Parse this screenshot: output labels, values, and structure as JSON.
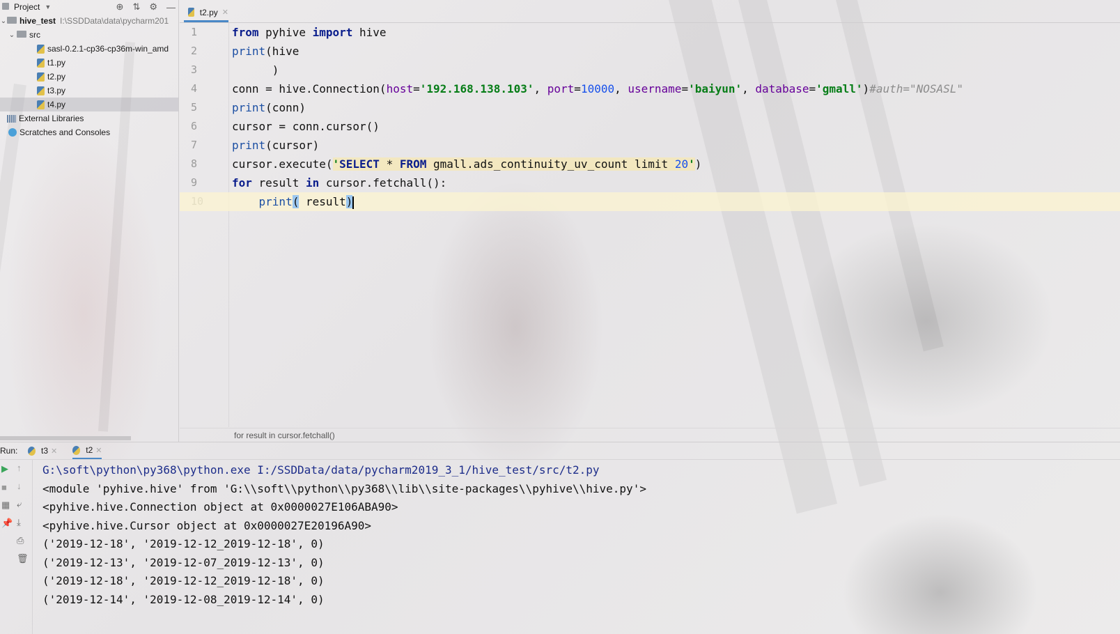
{
  "project_panel": {
    "title": "Project",
    "tree": [
      {
        "label": "hive_test",
        "path": "I:\\SSDData\\data\\pycharm201"
      },
      {
        "label": "src"
      },
      {
        "label": "sasl-0.2.1-cp36-cp36m-win_amd"
      },
      {
        "label": "t1.py"
      },
      {
        "label": "t2.py"
      },
      {
        "label": "t3.py"
      },
      {
        "label": "t4.py"
      },
      {
        "label": "External Libraries"
      },
      {
        "label": "Scratches and Consoles"
      }
    ]
  },
  "editor": {
    "tab_label": "t2.py",
    "line_numbers": [
      "1",
      "2",
      "3",
      "4",
      "5",
      "6",
      "7",
      "8",
      "9",
      "10"
    ],
    "lines": [
      "from pyhive import hive",
      "print(hive",
      "      )",
      "conn = hive.Connection(host='192.168.138.103', port=10000, username='baiyun', database='gmall')#auth=\"NOSASL\"",
      "print(conn)",
      "cursor = conn.cursor()",
      "print(cursor)",
      "cursor.execute('SELECT * FROM gmall.ads_continuity_uv_count limit 20')",
      "for result in cursor.fetchall():",
      "    print( result)"
    ],
    "tokens": {
      "from": "from",
      "pyhive": " pyhive ",
      "import": "import",
      "hive": " hive",
      "print": "print",
      "conn_assign": "conn = hive.Connection(",
      "host_kw": "host",
      "host_val": "'192.168.138.103'",
      "port_kw": "port",
      "port_val": "10000",
      "user_kw": "username",
      "user_val": "'baiyun'",
      "db_kw": "database",
      "db_val": "'gmall'",
      "comment": "#auth=\"NOSASL\"",
      "cursor_assign": "cursor = conn.cursor()",
      "exec_pre": "cursor.execute(",
      "sql_select": "SELECT",
      "sql_star": " * ",
      "sql_from": "FROM",
      "sql_table": " gmall.ads_continuity_uv_count ",
      "sql_limit": "limit",
      "sql_num": "20",
      "for": "for",
      "in": "in",
      "result": " result ",
      "fetch": " cursor.fetchall():",
      "result_arg": " result"
    },
    "breadcrumb": "for result in cursor.fetchall()"
  },
  "run_panel": {
    "label": "Run:",
    "tabs": [
      "t3",
      "t2"
    ],
    "console_lines": [
      "G:\\soft\\python\\py368\\python.exe I:/SSDData/data/pycharm2019_3_1/hive_test/src/t2.py",
      "<module 'pyhive.hive' from 'G:\\\\soft\\\\python\\\\py368\\\\lib\\\\site-packages\\\\pyhive\\\\hive.py'>",
      "<pyhive.hive.Connection object at 0x0000027E106ABA90>",
      "<pyhive.hive.Cursor object at 0x0000027E20196A90>",
      "('2019-12-18', '2019-12-12_2019-12-18', 0)",
      "('2019-12-13', '2019-12-07_2019-12-13', 0)",
      "('2019-12-18', '2019-12-12_2019-12-18', 0)",
      "('2019-12-14', '2019-12-08_2019-12-14', 0)"
    ]
  },
  "colors": {
    "keyword": "#0a1d8c",
    "string": "#067d17",
    "number": "#1750eb",
    "param": "#660099",
    "comment": "#8c8c8c",
    "accent": "#4a88c7"
  }
}
